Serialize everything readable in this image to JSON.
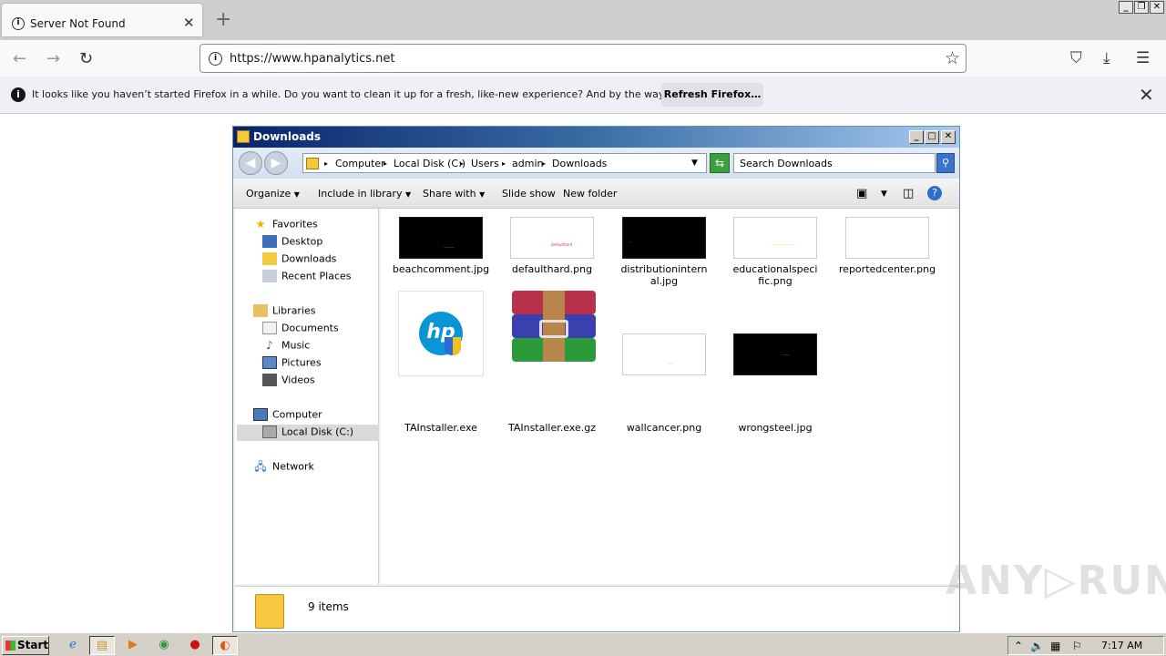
{
  "browser": {
    "tab_title": "Server Not Found",
    "url": "https://www.hpanalytics.net",
    "notification": {
      "text": "It looks like you haven’t started Firefox in a while. Do you want to clean it up for a fresh, like-new experience? And by the way, welcome back!",
      "button": "Refresh Firefox…"
    }
  },
  "explorer": {
    "title": "Downloads",
    "breadcrumb": [
      "Computer",
      "Local Disk (C:)",
      "Users",
      "admin",
      "Downloads"
    ],
    "search_placeholder": "Search Downloads",
    "toolbar": {
      "organize": "Organize",
      "include": "Include in library",
      "share": "Share with",
      "slideshow": "Slide show",
      "newfolder": "New folder"
    },
    "nav": {
      "favorites": "Favorites",
      "desktop": "Desktop",
      "downloads": "Downloads",
      "recent": "Recent Places",
      "libraries": "Libraries",
      "documents": "Documents",
      "music": "Music",
      "pictures": "Pictures",
      "videos": "Videos",
      "computer": "Computer",
      "localdisk": "Local Disk (C:)",
      "network": "Network"
    },
    "files": [
      {
        "name": "beachcomment.jpg",
        "thumb_color": "#000000",
        "thumb_text": "———"
      },
      {
        "name": "defaulthard.png",
        "thumb_color": "#ffffff",
        "thumb_text": "defaulthard"
      },
      {
        "name": "distributioninternal.jpg",
        "thumb_color": "#000000",
        "thumb_text": "—"
      },
      {
        "name": "educationalspecific.png",
        "thumb_color": "#ffffff",
        "thumb_text": "———————"
      },
      {
        "name": "reportedcenter.png",
        "thumb_color": "#ffffff",
        "thumb_text": ""
      },
      {
        "name": "TAInstaller.exe",
        "thumb_color": "#ffffff",
        "thumb_text": ""
      },
      {
        "name": "TAInstaller.exe.gz",
        "thumb_color": "#ffffff",
        "thumb_text": ""
      },
      {
        "name": "wallcancer.png",
        "thumb_color": "#ffffff",
        "thumb_text": "—"
      },
      {
        "name": "wrongsteel.jpg",
        "thumb_color": "#000000",
        "thumb_text": "——"
      }
    ],
    "status": "9 items"
  },
  "taskbar": {
    "start": "Start",
    "clock": "7:17 AM"
  },
  "watermark": "ANY▷RUN"
}
